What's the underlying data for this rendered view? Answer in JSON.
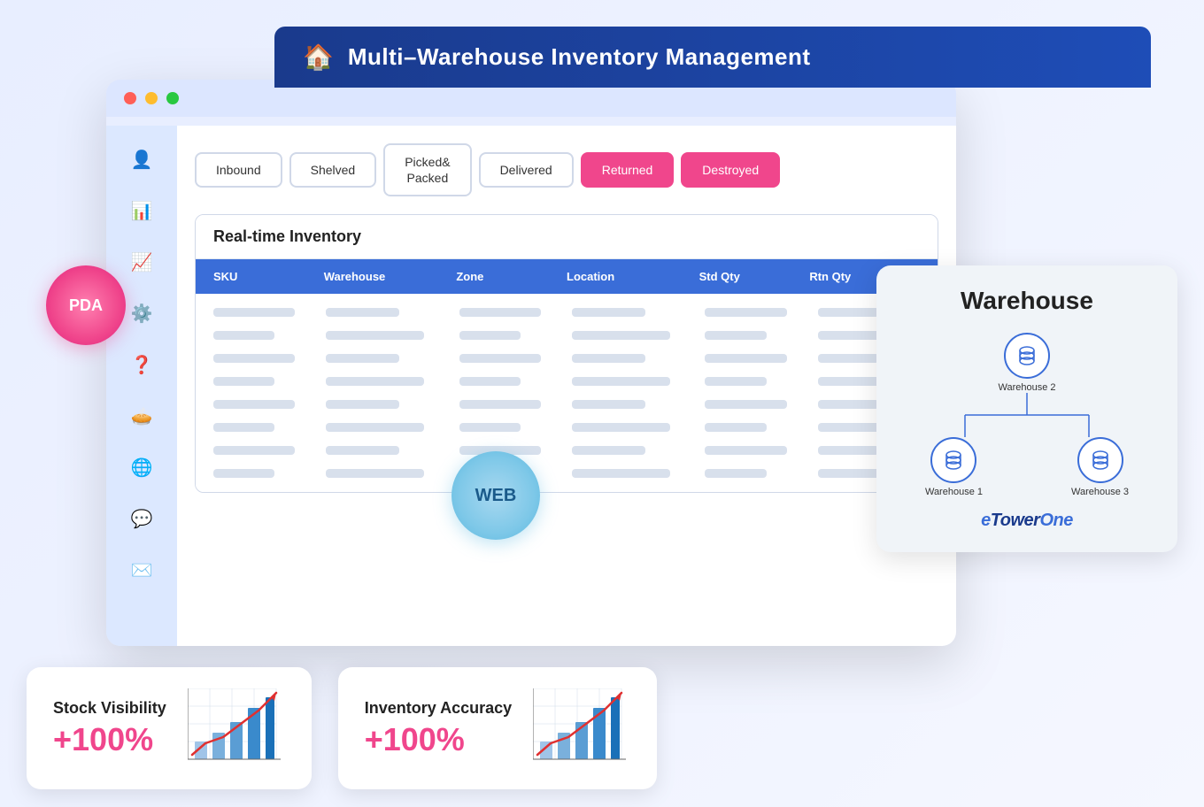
{
  "header": {
    "title": "Multi–Warehouse Inventory Management",
    "house_icon": "🏠"
  },
  "browser": {
    "dots": [
      "red",
      "yellow",
      "green"
    ]
  },
  "sidebar": {
    "icons": [
      {
        "name": "user-icon",
        "symbol": "👤"
      },
      {
        "name": "chart-icon",
        "symbol": "📊"
      },
      {
        "name": "trend-icon",
        "symbol": "📈"
      },
      {
        "name": "settings-icon",
        "symbol": "⚙️"
      },
      {
        "name": "help-icon",
        "symbol": "❓"
      },
      {
        "name": "pie-icon",
        "symbol": "🥧"
      },
      {
        "name": "globe-icon",
        "symbol": "🌐"
      },
      {
        "name": "chat-icon",
        "symbol": "💬"
      },
      {
        "name": "mail-icon",
        "symbol": "✉️"
      }
    ]
  },
  "tabs": [
    {
      "label": "Inbound",
      "state": "normal"
    },
    {
      "label": "Shelved",
      "state": "normal"
    },
    {
      "label": "Picked&\nPacked",
      "state": "normal"
    },
    {
      "label": "Delivered",
      "state": "normal"
    },
    {
      "label": "Returned",
      "state": "active-pink"
    },
    {
      "label": "Destroyed",
      "state": "active-pink"
    }
  ],
  "inventory": {
    "title": "Real-time Inventory",
    "columns": [
      "SKU",
      "Warehouse",
      "Zone",
      "Location",
      "Std Qty",
      "Rtn Qty"
    ]
  },
  "web_bubble": {
    "label": "WEB"
  },
  "pda_bubble": {
    "label": "PDA"
  },
  "warehouse_card": {
    "title": "Warehouse",
    "nodes": [
      {
        "label": "Warehouse 2"
      },
      {
        "label": "Warehouse 1"
      },
      {
        "label": "Warehouse 3"
      }
    ],
    "brand": "eTowerOne"
  },
  "stats": [
    {
      "label": "Stock Visibility",
      "value": "+100%"
    },
    {
      "label": "Inventory Accuracy",
      "value": "+100%"
    }
  ]
}
